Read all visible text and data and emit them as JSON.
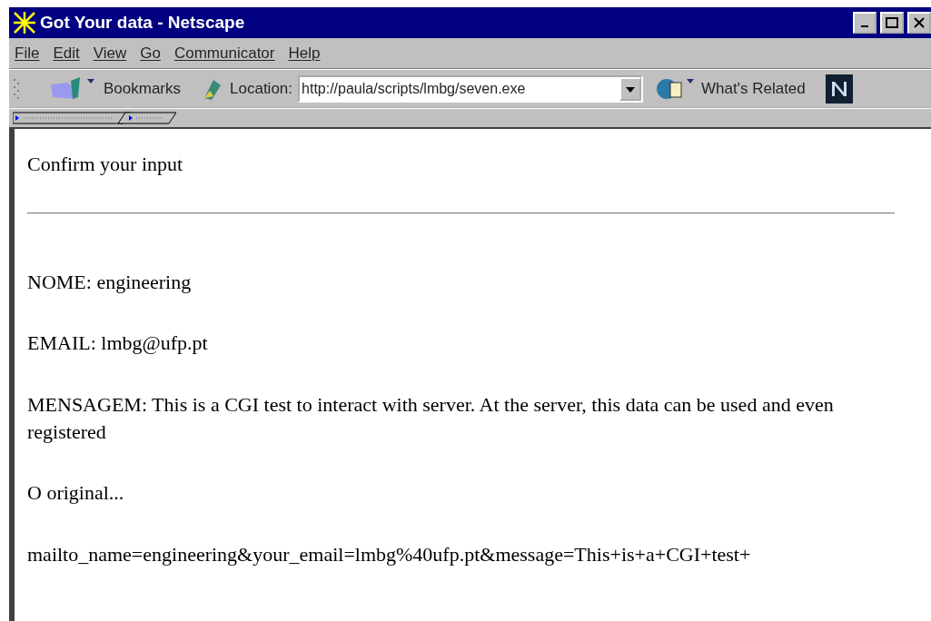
{
  "window": {
    "title": "Got Your data - Netscape"
  },
  "menu": [
    "File",
    "Edit",
    "View",
    "Go",
    "Communicator",
    "Help"
  ],
  "toolbar": {
    "bookmarks": "Bookmarks",
    "location_label": "Location:",
    "location_value": "http://paula/scripts/lmbg/seven.exe",
    "whats_related": "What's Related"
  },
  "page": {
    "heading": "Confirm your input",
    "fields": [
      {
        "label": "NOME:",
        "value": "engineering"
      },
      {
        "label": "EMAIL:",
        "value": "lmbg@ufp.pt"
      },
      {
        "label": "MENSAGEM:",
        "value": "This is a CGI test to interact with server. At the server, this data can be used and even registered"
      }
    ],
    "original_label": "O original...",
    "raw": "mailto_name=engineering&your_email=lmbg%40ufp.pt&message=This+is+a+CGI+test+"
  }
}
